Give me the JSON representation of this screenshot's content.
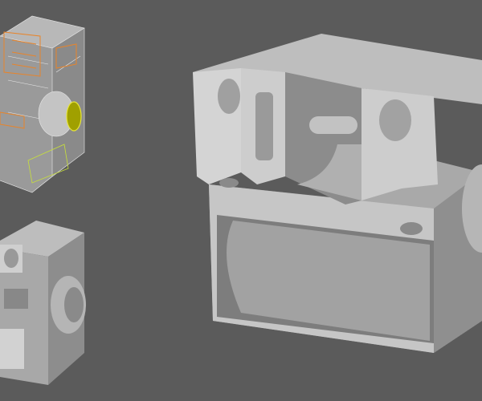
{
  "colors": {
    "background": "#5b5b5b",
    "model_light": "#c9c9c9",
    "model_mid": "#a9a9a9",
    "model_dark": "#7e7e7e",
    "wire_orange": "#e8842a",
    "wire_yellow": "#e6e43a",
    "wire_white": "#e8e8e8"
  }
}
